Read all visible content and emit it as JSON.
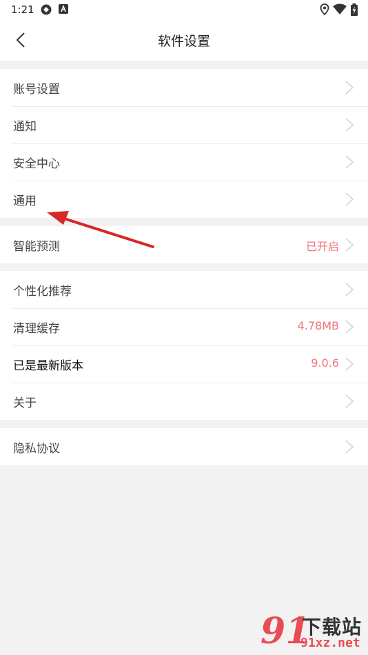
{
  "status_bar": {
    "time": "1:21"
  },
  "header": {
    "title": "软件设置",
    "back_icon": "chevron-left-icon"
  },
  "groups": [
    {
      "rows": [
        {
          "label": "账号设置",
          "value": ""
        },
        {
          "label": "通知",
          "value": ""
        },
        {
          "label": "安全中心",
          "value": ""
        },
        {
          "label": "通用",
          "value": ""
        }
      ]
    },
    {
      "rows": [
        {
          "label": "智能预测",
          "value": "已开启"
        }
      ]
    },
    {
      "rows": [
        {
          "label": "个性化推荐",
          "value": ""
        },
        {
          "label": "清理缓存",
          "value": "4.78MB"
        },
        {
          "label": "已是最新版本",
          "value": "9.0.6"
        },
        {
          "label": "关于",
          "value": ""
        }
      ]
    },
    {
      "rows": [
        {
          "label": "隐私协议",
          "value": ""
        }
      ]
    }
  ],
  "colors": {
    "accent": "#f2737b",
    "background": "#f2f2f2",
    "annotation_arrow": "#d62828"
  },
  "watermark": {
    "logo": "91",
    "top_text": "下载站",
    "bottom_text": "91xz.net"
  }
}
